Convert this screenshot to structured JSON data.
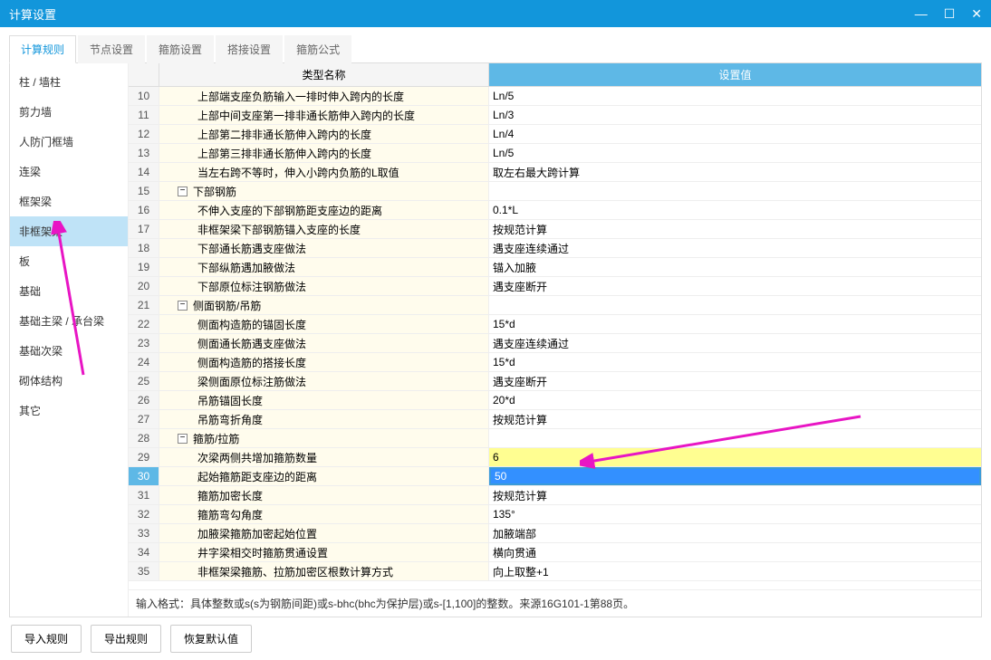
{
  "window": {
    "title": "计算设置"
  },
  "win_controls": {
    "min": "—",
    "max": "☐",
    "close": "✕"
  },
  "tabs": [
    {
      "label": "计算规则",
      "active": true
    },
    {
      "label": "节点设置",
      "active": false
    },
    {
      "label": "箍筋设置",
      "active": false
    },
    {
      "label": "搭接设置",
      "active": false
    },
    {
      "label": "箍筋公式",
      "active": false
    }
  ],
  "sidebar": [
    {
      "label": "柱 / 墙柱"
    },
    {
      "label": "剪力墙"
    },
    {
      "label": "人防门框墙"
    },
    {
      "label": "连梁"
    },
    {
      "label": "框架梁"
    },
    {
      "label": "非框架梁",
      "active": true
    },
    {
      "label": "板"
    },
    {
      "label": "基础"
    },
    {
      "label": "基础主梁 / 承台梁"
    },
    {
      "label": "基础次梁"
    },
    {
      "label": "砌体结构"
    },
    {
      "label": "其它"
    }
  ],
  "table": {
    "headers": {
      "num": "",
      "name": "类型名称",
      "val": "设置值"
    },
    "rows": [
      {
        "n": "10",
        "name": "上部端支座负筋输入一排时伸入跨内的长度",
        "val": "Ln/5",
        "indent": 2
      },
      {
        "n": "11",
        "name": "上部中间支座第一排非通长筋伸入跨内的长度",
        "val": "Ln/3",
        "indent": 2
      },
      {
        "n": "12",
        "name": "上部第二排非通长筋伸入跨内的长度",
        "val": "Ln/4",
        "indent": 2
      },
      {
        "n": "13",
        "name": "上部第三排非通长筋伸入跨内的长度",
        "val": "Ln/5",
        "indent": 2
      },
      {
        "n": "14",
        "name": "当左右跨不等时，伸入小跨内负筋的L取值",
        "val": "取左右最大跨计算",
        "indent": 2
      },
      {
        "n": "15",
        "name": "下部钢筋",
        "val": "",
        "indent": 1,
        "group": true
      },
      {
        "n": "16",
        "name": "不伸入支座的下部钢筋距支座边的距离",
        "val": "0.1*L",
        "indent": 2
      },
      {
        "n": "17",
        "name": "非框架梁下部钢筋锚入支座的长度",
        "val": "按规范计算",
        "indent": 2
      },
      {
        "n": "18",
        "name": "下部通长筋遇支座做法",
        "val": "遇支座连续通过",
        "indent": 2
      },
      {
        "n": "19",
        "name": "下部纵筋遇加腋做法",
        "val": "锚入加腋",
        "indent": 2
      },
      {
        "n": "20",
        "name": "下部原位标注钢筋做法",
        "val": "遇支座断开",
        "indent": 2
      },
      {
        "n": "21",
        "name": "侧面钢筋/吊筋",
        "val": "",
        "indent": 1,
        "group": true
      },
      {
        "n": "22",
        "name": "侧面构造筋的锚固长度",
        "val": "15*d",
        "indent": 2
      },
      {
        "n": "23",
        "name": "侧面通长筋遇支座做法",
        "val": "遇支座连续通过",
        "indent": 2
      },
      {
        "n": "24",
        "name": "侧面构造筋的搭接长度",
        "val": "15*d",
        "indent": 2
      },
      {
        "n": "25",
        "name": "梁侧面原位标注筋做法",
        "val": "遇支座断开",
        "indent": 2
      },
      {
        "n": "26",
        "name": "吊筋锚固长度",
        "val": "20*d",
        "indent": 2
      },
      {
        "n": "27",
        "name": "吊筋弯折角度",
        "val": "按规范计算",
        "indent": 2
      },
      {
        "n": "28",
        "name": "箍筋/拉筋",
        "val": "",
        "indent": 1,
        "group": true
      },
      {
        "n": "29",
        "name": "次梁两侧共增加箍筋数量",
        "val": "6",
        "indent": 2,
        "hl": true
      },
      {
        "n": "30",
        "name": "起始箍筋距支座边的距离",
        "val": "50",
        "indent": 2,
        "sel": true
      },
      {
        "n": "31",
        "name": "箍筋加密长度",
        "val": "按规范计算",
        "indent": 2
      },
      {
        "n": "32",
        "name": "箍筋弯勾角度",
        "val": "135°",
        "indent": 2
      },
      {
        "n": "33",
        "name": "加腋梁箍筋加密起始位置",
        "val": "加腋端部",
        "indent": 2
      },
      {
        "n": "34",
        "name": "井字梁相交时箍筋贯通设置",
        "val": "横向贯通",
        "indent": 2
      },
      {
        "n": "35",
        "name": "非框架梁箍筋、拉筋加密区根数计算方式",
        "val": "向上取整+1",
        "indent": 2
      }
    ],
    "footer": "输入格式：具体整数或s(s为钢筋间距)或s-bhc(bhc为保护层)或s-[1,100]的整数。来源16G101-1第88页。"
  },
  "chart_data": null,
  "buttons": {
    "import": "导入规则",
    "export": "导出规则",
    "reset": "恢复默认值"
  }
}
